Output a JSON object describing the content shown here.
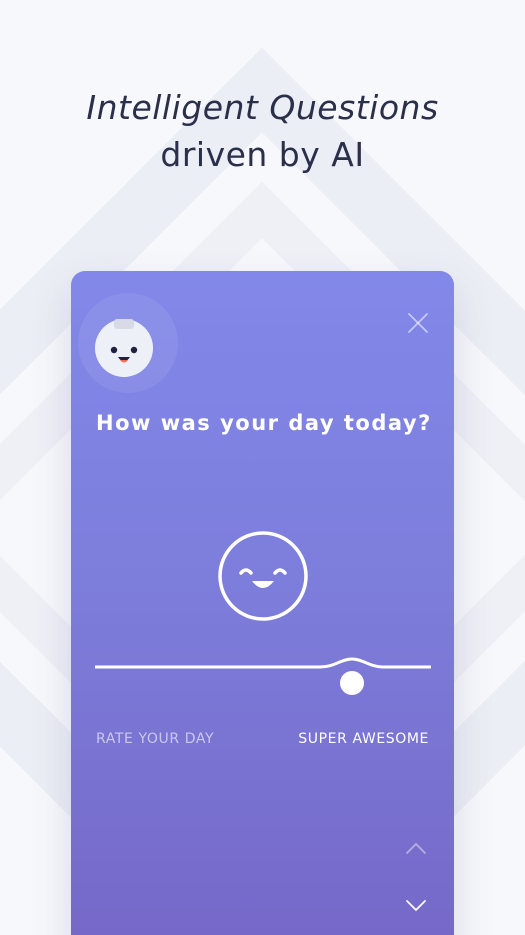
{
  "headline": {
    "line1": "Intelligent Questions",
    "line2": "driven by AI"
  },
  "card": {
    "question": "How was your day today?",
    "mood_icon": "smiling-face-icon",
    "bot_icon": "robot-avatar-icon",
    "close_icon": "close-icon",
    "slider": {
      "left_label": "RATE YOUR DAY",
      "right_label": "SUPER AWESOME",
      "value_fraction": 0.77
    },
    "nav": {
      "up_icon": "chevron-up-icon",
      "down_icon": "chevron-down-icon"
    }
  },
  "colors": {
    "card_top": "#8288e9",
    "card_bottom": "#7566c6",
    "headline": "#2a2f4a",
    "white": "#ffffff"
  }
}
